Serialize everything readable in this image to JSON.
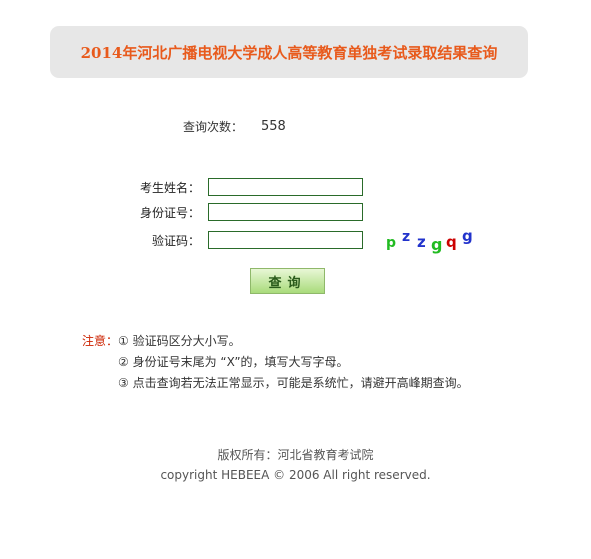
{
  "header": {
    "title": "2014年河北广播电视大学成人高等教育单独考试录取结果查询"
  },
  "counter": {
    "label": "查询次数：",
    "value": "558"
  },
  "form": {
    "name_label": "考生姓名：",
    "id_label": "身份证号：",
    "captcha_label": "验证码：",
    "name_value": "",
    "id_value": "",
    "captcha_value": "",
    "captcha_chars": [
      "p",
      "z",
      "z",
      "g",
      "q",
      "g"
    ],
    "captcha_colors": [
      "#22bb22",
      "#2233cc",
      "#2233cc",
      "#22bb22",
      "#cc0000",
      "#2233cc"
    ]
  },
  "query_button": {
    "label": "查询"
  },
  "notes": {
    "head": "注意：",
    "items": [
      "① 验证码区分大小写。",
      "② 身份证号末尾为 “X”的，填写大写字母。",
      "③ 点击查询若无法正常显示，可能是系统忙，请避开高峰期查询。"
    ]
  },
  "footer": {
    "copyright_cn": "版权所有：河北省教育考试院",
    "copyright_en": "copyright HEBEEA © 2006 All right reserved."
  }
}
